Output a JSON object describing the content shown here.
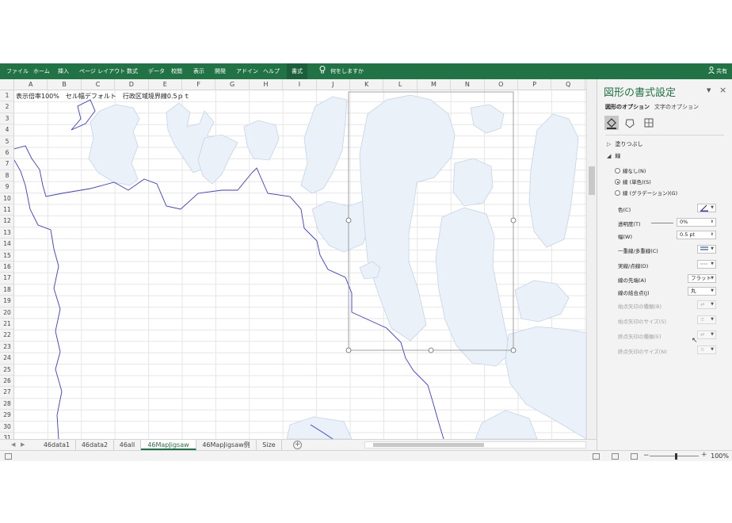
{
  "ribbon": {
    "tabs": [
      "ファイル",
      "ホーム",
      "挿入",
      "ページ レイアウト",
      "数式",
      "データ",
      "校閲",
      "表示",
      "開発",
      "アドイン",
      "ヘルプ",
      "書式"
    ],
    "active_tab": "書式",
    "search_placeholder": "何をしますか",
    "share_label": "共有"
  },
  "columns": [
    "A",
    "B",
    "C",
    "D",
    "E",
    "F",
    "G",
    "H",
    "I",
    "J",
    "K",
    "L",
    "M",
    "N",
    "O",
    "P",
    "Q"
  ],
  "rows": [
    "1",
    "2",
    "3",
    "4",
    "5",
    "6",
    "7",
    "8",
    "9",
    "10",
    "11",
    "12",
    "13",
    "14",
    "15",
    "16",
    "17",
    "18",
    "19",
    "20",
    "21",
    "22",
    "23",
    "24",
    "25",
    "26",
    "27",
    "28",
    "29",
    "30",
    "31"
  ],
  "cell_A1": "表示倍率100%　セル幅デフォルト　行政区域境界線0.5ｐｔ",
  "sheets": [
    "46data1",
    "46data2",
    "46all",
    "46MapJigsaw",
    "46MapJigsaw例",
    "Size"
  ],
  "active_sheet": "46MapJigsaw",
  "status": {
    "zoom": "100%"
  },
  "pane": {
    "title": "図形の書式設定",
    "tab_shape": "図形のオプション",
    "tab_text": "文字のオプション",
    "section_fill": "塗りつぶし",
    "section_line": "線",
    "line_none": "線なし(N)",
    "line_solid": "線 (単色)(S)",
    "line_gradient": "線 (グラデーション)(G)",
    "color_label": "色(C)",
    "transparency_label": "透明度(T)",
    "transparency_value": "0%",
    "width_label": "幅(W)",
    "width_value": "0.5 pt",
    "compound_label": "一重線/多重線(C)",
    "dash_label": "実線/点線(D)",
    "cap_label": "線の先端(A)",
    "cap_value": "フラット",
    "join_label": "線の結合点(J)",
    "join_value": "丸",
    "begin_type_label": "始点矢印の種類(B)",
    "begin_size_label": "始点矢印のサイズ(S)",
    "end_type_label": "終点矢印の種類(E)",
    "end_size_label": "終点矢印のサイズ(N)"
  },
  "colors": {
    "ribbon": "#217346",
    "map_fill": "#eaf1f9",
    "map_outline": "#3a3ad6",
    "shape_outline": "#8da6c4"
  }
}
